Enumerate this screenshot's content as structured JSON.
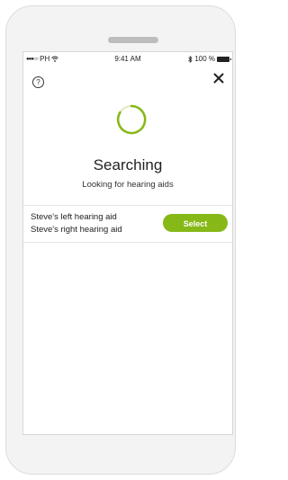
{
  "status_bar": {
    "carrier": "PH",
    "time": "9:41 AM",
    "battery": "100 %"
  },
  "header": {
    "help_icon": "question-circle-icon",
    "help_glyph": "?",
    "close_icon": "close-icon"
  },
  "main": {
    "title": "Searching",
    "subtitle": "Looking for hearing aids"
  },
  "devices": {
    "left_name": "Steve's left hearing aid",
    "right_name": "Steve's right hearing aid",
    "select_label": "Select"
  },
  "colors": {
    "accent": "#86b817",
    "spinner_track": "#e3efc4"
  }
}
